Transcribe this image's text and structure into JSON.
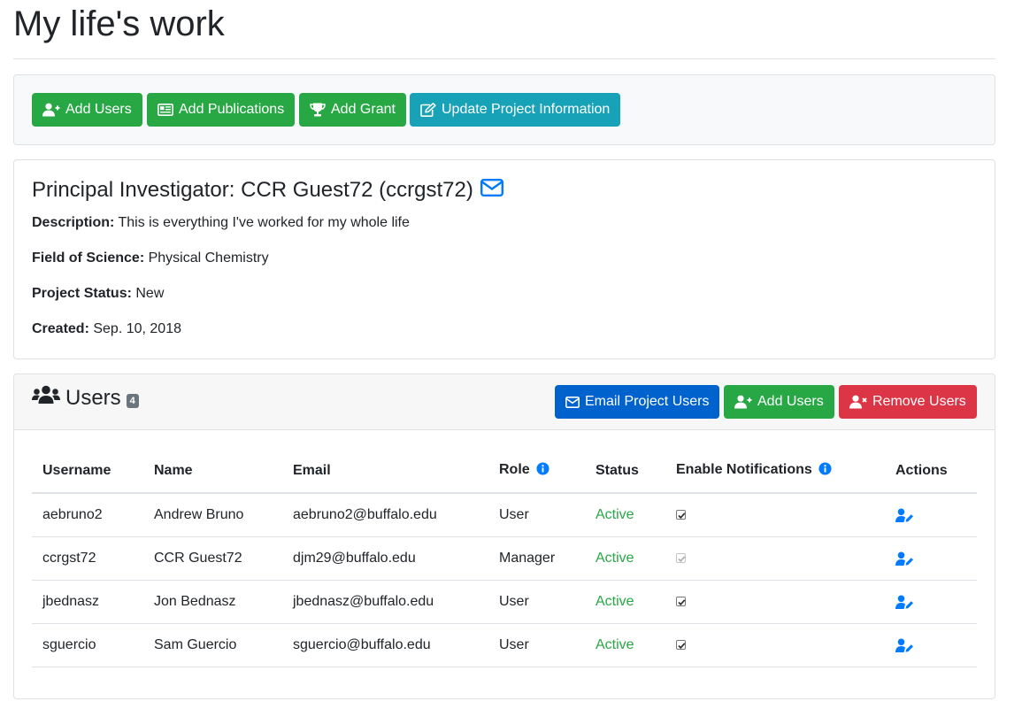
{
  "page_title": "My life's work",
  "toolbar": {
    "add_users": "Add Users",
    "add_publications": "Add Publications",
    "add_grant": "Add Grant",
    "update_project": "Update Project Information"
  },
  "project": {
    "pi_heading": "Principal Investigator: CCR Guest72 (ccrgst72)",
    "description_label": "Description:",
    "description": "This is everything I've worked for my whole life",
    "field_label": "Field of Science:",
    "field": "Physical Chemistry",
    "status_label": "Project Status:",
    "status": "New",
    "created_label": "Created:",
    "created": "Sep. 10, 2018"
  },
  "users": {
    "title": "Users",
    "count": "4",
    "email_button": "Email Project Users",
    "add_button": "Add Users",
    "remove_button": "Remove Users",
    "columns": [
      "Username",
      "Name",
      "Email",
      "Role",
      "Status",
      "Enable Notifications",
      "Actions"
    ],
    "rows": [
      {
        "username": "aebruno2",
        "name": "Andrew Bruno",
        "email": "aebruno2@buffalo.edu",
        "role": "User",
        "status": "Active",
        "notifications": true,
        "notifications_disabled": false
      },
      {
        "username": "ccrgst72",
        "name": "CCR Guest72",
        "email": "djm29@buffalo.edu",
        "role": "Manager",
        "status": "Active",
        "notifications": true,
        "notifications_disabled": true
      },
      {
        "username": "jbednasz",
        "name": "Jon Bednasz",
        "email": "jbednasz@buffalo.edu",
        "role": "User",
        "status": "Active",
        "notifications": true,
        "notifications_disabled": false
      },
      {
        "username": "sguercio",
        "name": "Sam Guercio",
        "email": "sguercio@buffalo.edu",
        "role": "User",
        "status": "Active",
        "notifications": true,
        "notifications_disabled": false
      }
    ]
  },
  "colors": {
    "green": "#28a745",
    "teal": "#17a2b8",
    "blue": "#0062cc",
    "red": "#dc3545",
    "link": "#007bff"
  },
  "icons": {
    "add_users": "user-plus-icon",
    "add_publications": "newspaper-icon",
    "add_grant": "trophy-icon",
    "update_project": "edit-icon",
    "pi_email": "envelope-icon",
    "users_title": "users-icon",
    "email_users": "envelope-icon",
    "remove_users": "user-times-icon",
    "info": "info-circle-icon",
    "edit_user": "user-edit-icon"
  }
}
